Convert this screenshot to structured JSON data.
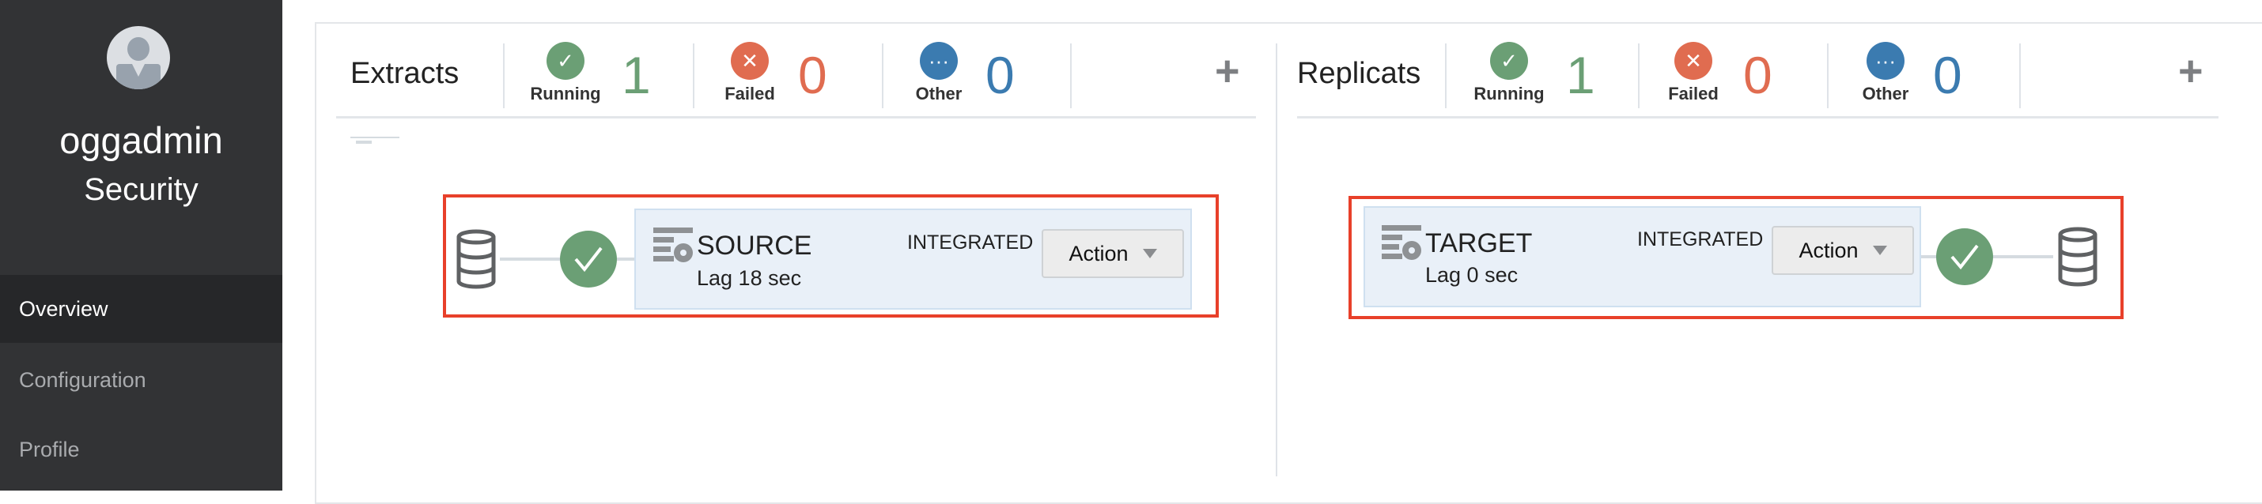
{
  "sidebar": {
    "username": "oggadmin",
    "role": "Security",
    "nav": [
      {
        "label": "Overview",
        "active": true
      },
      {
        "label": "Configuration",
        "active": false
      },
      {
        "label": "Profile",
        "active": false
      }
    ]
  },
  "extracts": {
    "title": "Extracts",
    "running": {
      "label": "Running",
      "count": "1"
    },
    "failed": {
      "label": "Failed",
      "count": "0"
    },
    "other": {
      "label": "Other",
      "count": "0"
    },
    "add_icon": "plus-icon",
    "process": {
      "name": "SOURCE",
      "lag": "Lag 18 sec",
      "type": "INTEGRATED",
      "action_label": "Action",
      "status": "running"
    }
  },
  "replicats": {
    "title": "Replicats",
    "running": {
      "label": "Running",
      "count": "1"
    },
    "failed": {
      "label": "Failed",
      "count": "0"
    },
    "other": {
      "label": "Other",
      "count": "0"
    },
    "add_icon": "plus-icon",
    "process": {
      "name": "TARGET",
      "lag": "Lag 0 sec",
      "type": "INTEGRATED",
      "action_label": "Action",
      "status": "running"
    }
  },
  "colors": {
    "running": "#6b9f75",
    "failed": "#e06c50",
    "other": "#3b7bb0",
    "highlight": "#e8402a"
  }
}
